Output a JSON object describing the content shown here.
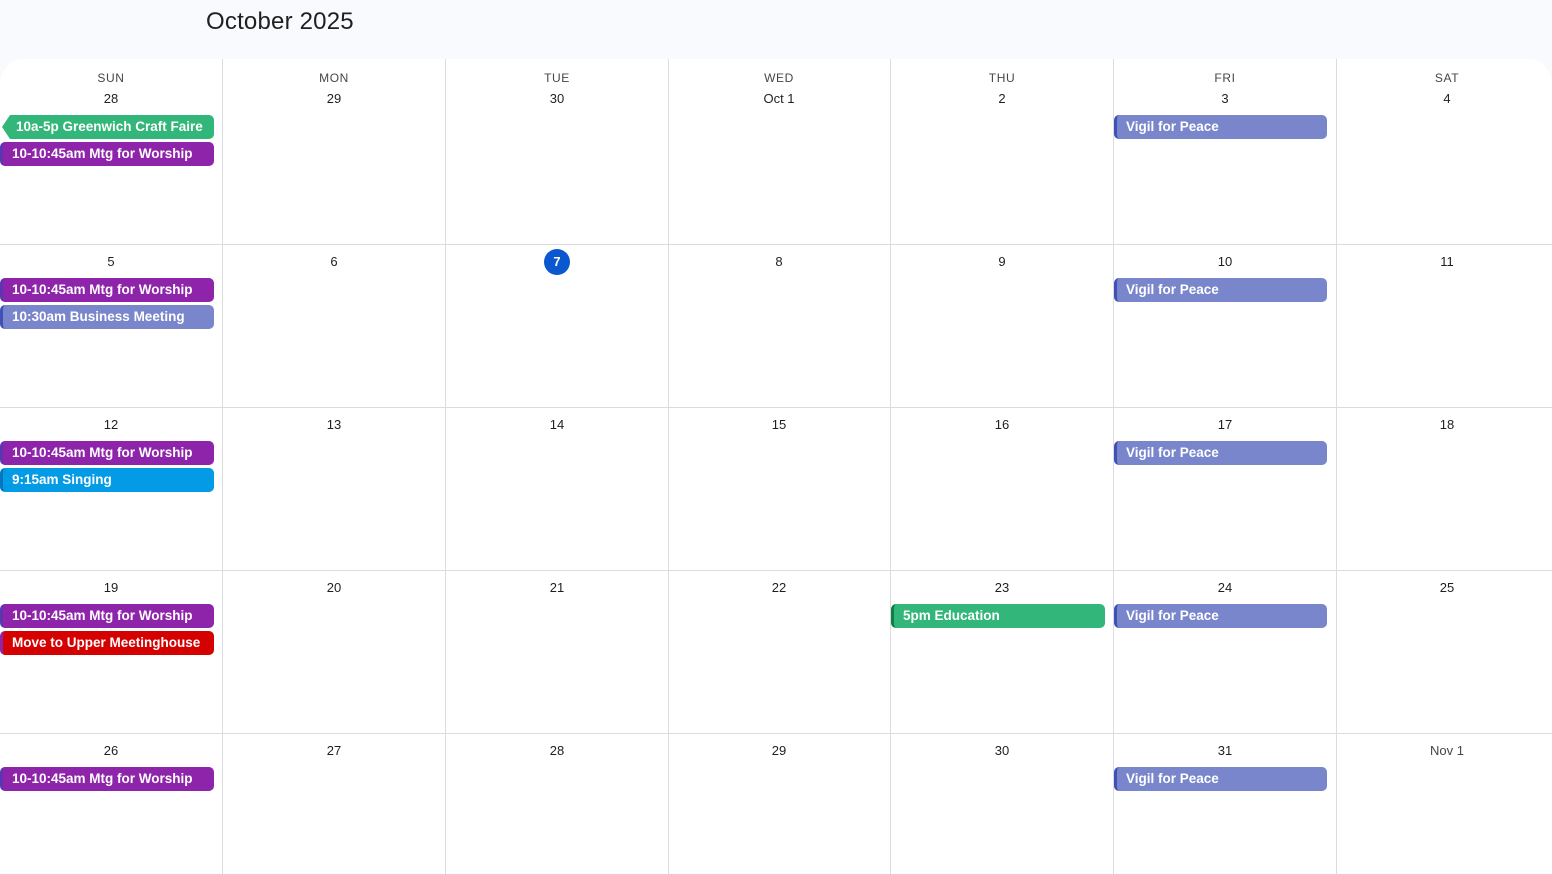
{
  "header": {
    "title": "October 2025"
  },
  "weekdays": [
    "SUN",
    "MON",
    "TUE",
    "WED",
    "THU",
    "FRI",
    "SAT"
  ],
  "weeks": [
    [
      "28",
      "29",
      "30",
      "Oct 1",
      "2",
      "3",
      "4"
    ],
    [
      "5",
      "6",
      "7",
      "8",
      "9",
      "10",
      "11"
    ],
    [
      "12",
      "13",
      "14",
      "15",
      "16",
      "17",
      "18"
    ],
    [
      "19",
      "20",
      "21",
      "22",
      "23",
      "24",
      "25"
    ],
    [
      "26",
      "27",
      "28",
      "29",
      "30",
      "31",
      "Nov 1"
    ]
  ],
  "today": "7",
  "events": {
    "craft_faire": "10a-5p Greenwich Craft Faire",
    "worship": "10-10:45am Mtg for Worship",
    "vigil": "Vigil for Peace",
    "business": "10:30am Business Meeting",
    "singing": "9:15am Singing",
    "education": "5pm Education",
    "move": "Move to Upper Meetinghouse"
  },
  "colors": {
    "worship": "#8e24aa",
    "vigil": "#7986cb",
    "craft_faire": "#33b679",
    "singing": "#039be5",
    "move": "#d50000",
    "today": "#0b57d0"
  }
}
